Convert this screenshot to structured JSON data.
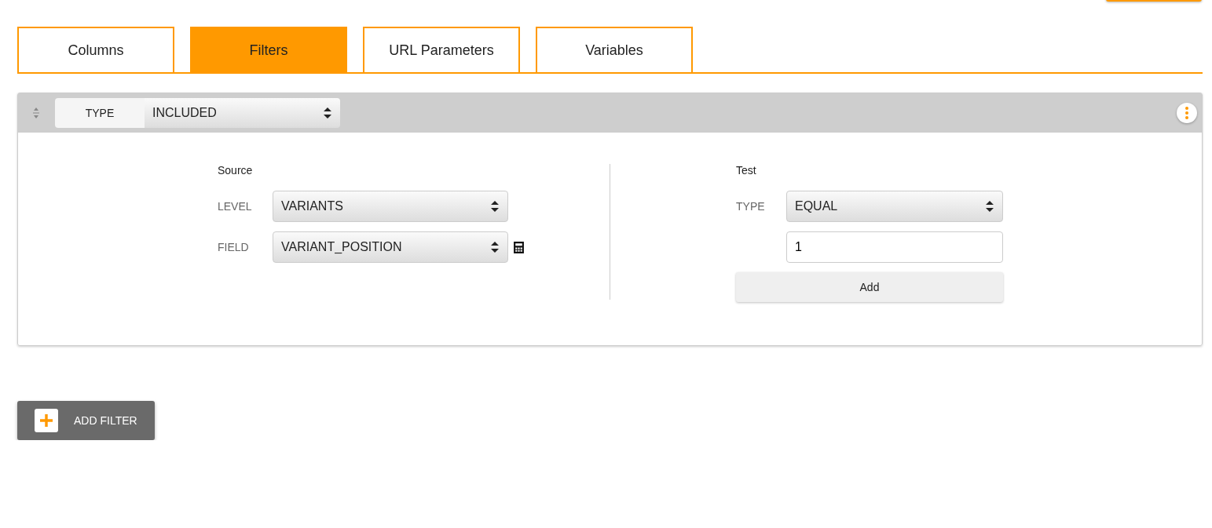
{
  "tabs": [
    {
      "label": "Columns",
      "selected": false
    },
    {
      "label": "Filters",
      "selected": true
    },
    {
      "label": "URL Parameters",
      "selected": false
    },
    {
      "label": "Variables",
      "selected": false
    }
  ],
  "filter": {
    "type_label": "TYPE",
    "type_value": "INCLUDED",
    "source": {
      "title": "Source",
      "fields": [
        {
          "label": "LEVEL",
          "value": "VARIANTS",
          "calculator": false
        },
        {
          "label": "FIELD",
          "value": "VARIANT_POSITION",
          "calculator": true
        }
      ]
    },
    "test": {
      "title": "Test",
      "type_label": "TYPE",
      "type_value": "EQUAL",
      "input_value": "1",
      "add_button": "Add"
    }
  },
  "add_filter_button": "ADD FILTER"
}
